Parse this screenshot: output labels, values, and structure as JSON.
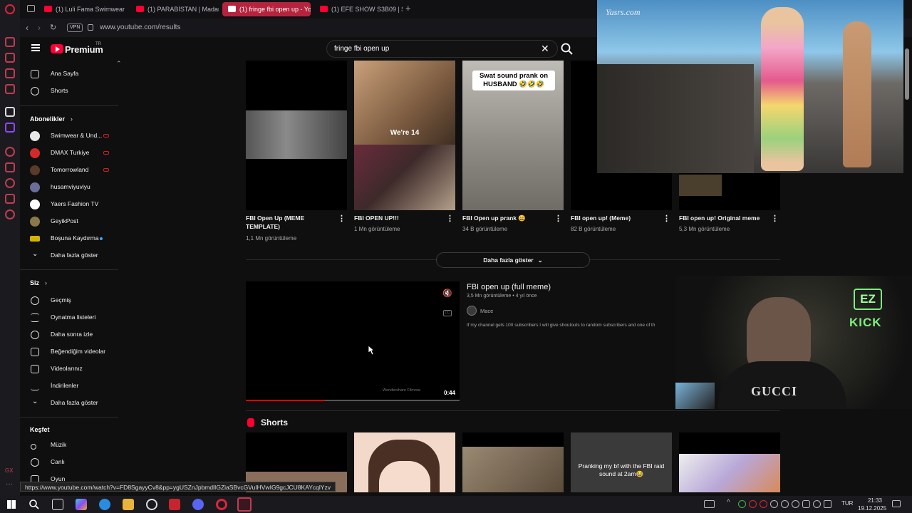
{
  "browser": {
    "tabs": [
      {
        "label": "(1) Luli Fama Swimwear F..."
      },
      {
        "label": "(1) PARABİSTAN | Madara"
      },
      {
        "label": "(1) fringe fbi open up - Yo"
      },
      {
        "label": "(1) EFE SHOW S3B09 | $A"
      }
    ],
    "new_tab": "+",
    "vpn_badge": "VPN",
    "url": "www.youtube.com/results"
  },
  "header": {
    "brand": "Premium",
    "brand_sup": "TR",
    "search_value": "fringe fbi open up",
    "clear": "✕"
  },
  "sidebar": {
    "main": [
      {
        "label": "Ana Sayfa"
      },
      {
        "label": "Shorts"
      }
    ],
    "subs_heading": "Abonelikler",
    "subs": [
      {
        "label": "Swimwear & Und...",
        "color": "#e8e8e8"
      },
      {
        "label": "DMAX Turkiye",
        "color": "#d22a2a"
      },
      {
        "label": "Tomorrowland",
        "color": "#5a3a2a"
      },
      {
        "label": "husamviyuviyu",
        "color": "#6d6d9a"
      },
      {
        "label": "Yaers Fashion TV",
        "color": "#ffffff"
      },
      {
        "label": "GeyikPost",
        "color": "#8a7a4a"
      },
      {
        "label": "Boşuna Kaydırma",
        "color": "#d4b400"
      },
      {
        "label": "Daha fazla göster"
      }
    ],
    "you_heading": "Siz",
    "you": [
      {
        "label": "Geçmiş"
      },
      {
        "label": "Oynatma listeleri"
      },
      {
        "label": "Daha sonra izle"
      },
      {
        "label": "Beğendiğim videolar"
      },
      {
        "label": "Videolarınız"
      },
      {
        "label": "İndirilenler"
      },
      {
        "label": "Daha fazla göster"
      }
    ],
    "explore_heading": "Keşfet",
    "explore": [
      {
        "label": "Müzik"
      },
      {
        "label": "Canlı"
      },
      {
        "label": "Oyun"
      }
    ]
  },
  "shorts_row": [
    {
      "title": "FBI Open Up (MEME TEMPLATE)",
      "views": "1,1 Mn görüntüleme"
    },
    {
      "title": "FBI OPEN UP!!!",
      "views": "1 Mn görüntüleme",
      "overlay": "We're 14"
    },
    {
      "title": "FBI Open up prank 😄",
      "views": "34 B görüntüleme",
      "overlay": "Swat sound prank on HUSBAND 🤣🤣🤣"
    },
    {
      "title": "FBI open up! (Meme)",
      "views": "82 B görüntüleme"
    },
    {
      "title": "FBI open up! Original meme",
      "views": "5,3 Mn görüntüleme"
    }
  ],
  "show_more": "Daha fazla göster",
  "video": {
    "title": "FBI open up (full meme)",
    "meta": "3,5 Mn görüntüleme • 4 yıl önce",
    "channel": "Mace",
    "description": "If my channel gets 100 subscribers I will give shoutouts to random subscribers and one of th",
    "duration": "0:44",
    "progress": 0.37,
    "watermark": "Wondershare Filmora"
  },
  "shorts_section": {
    "title": "Shorts",
    "overlay_4": "Pranking my bf with the FBI raid sound at 2am😂"
  },
  "pip_watermark": "Yasrs.com",
  "streamer_sign": {
    "line1": "EZ",
    "line2": "KICK"
  },
  "streamer_shirt": "GUCCI",
  "status_url": "https://www.youtube.com/watch?v=FD8SgayyCv8&pp=ygUSZnJpbmdlIGZiaSBvcGVuIHVwIG9gcJCU8KAYcqlYzv",
  "taskbar": {
    "lang": "TUR",
    "time": "21:33",
    "date": "19.12.2025"
  }
}
